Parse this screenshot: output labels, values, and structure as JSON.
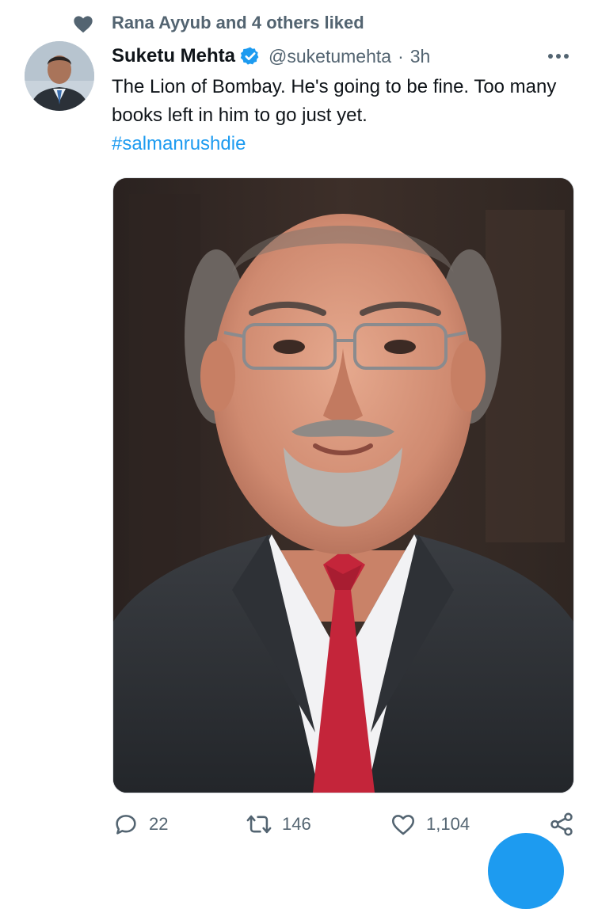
{
  "social_context": {
    "icon": "heart-icon",
    "text": "Rana Ayyub and 4 others liked"
  },
  "author": {
    "display_name": "Suketu Mehta",
    "verified": true,
    "handle": "@suketumehta",
    "separator": "·",
    "time": "3h"
  },
  "tweet": {
    "text": "The Lion of Bombay. He's going to be fine. Too many books left in him to go just yet.",
    "hashtag": "#salmanrushdie"
  },
  "actions": {
    "reply_count": "22",
    "retweet_count": "146",
    "like_count": "1,104"
  },
  "colors": {
    "accent": "#1d9bf0",
    "secondary_text": "#536471",
    "primary_text": "#0f1419"
  }
}
